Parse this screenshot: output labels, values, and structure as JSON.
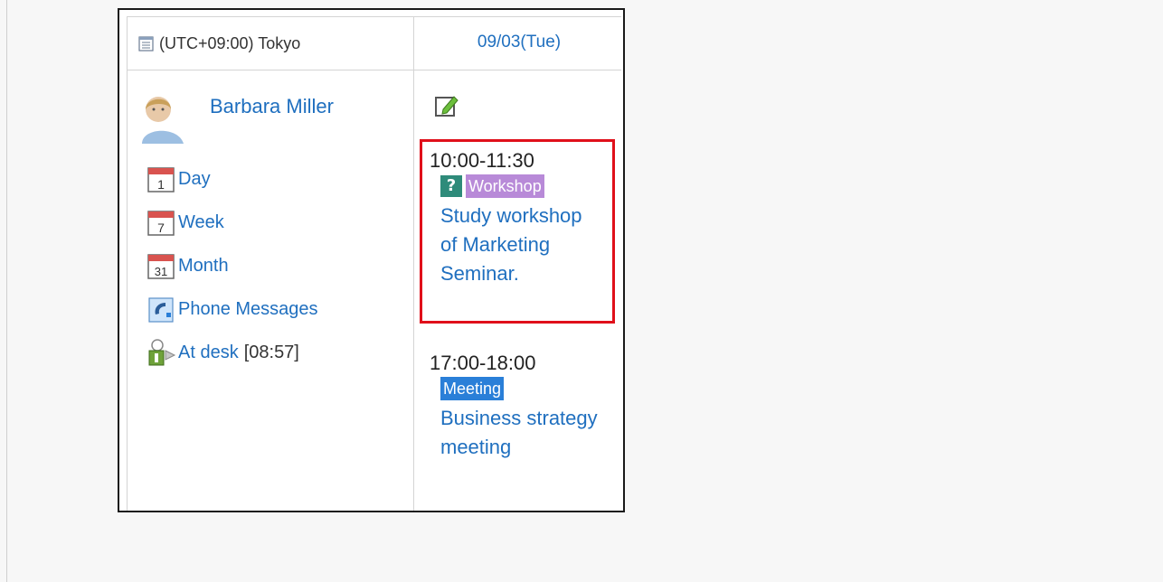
{
  "header": {
    "timezone_label": "(UTC+09:00) Tokyo",
    "date_label": "09/03(Tue)"
  },
  "user": {
    "name": "Barbara Miller"
  },
  "nav": {
    "items": [
      {
        "label": "Day",
        "icon": "calendar-day-icon",
        "badge": "1"
      },
      {
        "label": "Week",
        "icon": "calendar-week-icon",
        "badge": "7"
      },
      {
        "label": "Month",
        "icon": "calendar-month-icon",
        "badge": "31"
      },
      {
        "label": "Phone Messages",
        "icon": "phone-icon"
      },
      {
        "label": "At desk",
        "icon": "presence-icon",
        "extra": "[08:57]"
      }
    ]
  },
  "events": [
    {
      "time": "10:00-11:30",
      "tag": "Workshop",
      "title": "Study workshop of Marketing Seminar.",
      "has_question_icon": true,
      "highlighted": true
    },
    {
      "time": "17:00-18:00",
      "tag": "Meeting",
      "title": "Business strategy meeting",
      "has_question_icon": false,
      "highlighted": false
    }
  ],
  "colors": {
    "link": "#1f6fbf",
    "highlight_border": "#e0101a",
    "workshop_tag": "#b88ad8",
    "meeting_tag": "#2a7fd8",
    "question_icon": "#2e8b7a"
  }
}
